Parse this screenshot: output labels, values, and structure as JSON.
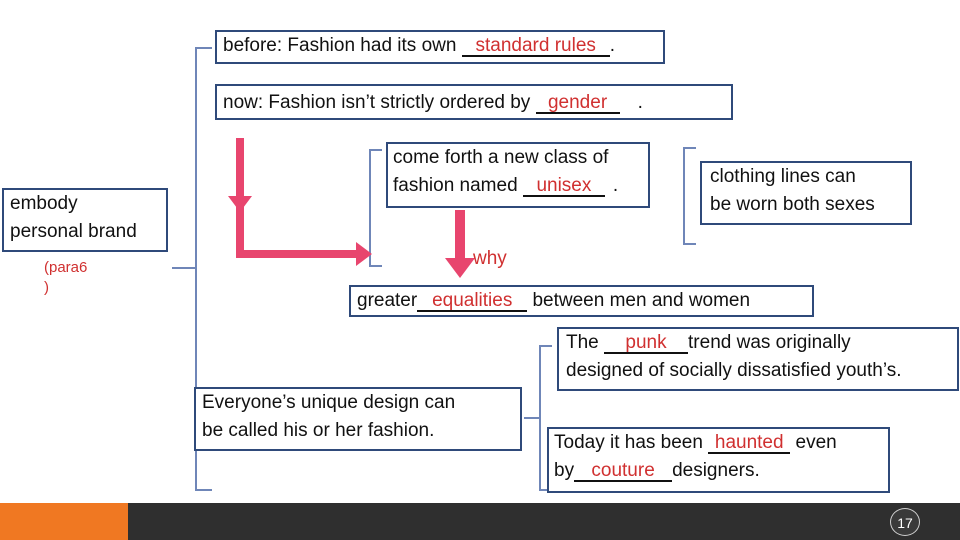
{
  "before": {
    "prefix": "before: Fashion had its own ",
    "answer": "standard rules",
    "suffix": "."
  },
  "now": {
    "prefix": "now: Fashion isn’t strictly ordered by ",
    "answer": "gender",
    "suffix": "."
  },
  "unisex_box": {
    "line1": "come forth a new class of",
    "prefix": "fashion named ",
    "answer": "unisex",
    "suffix": "."
  },
  "clothing_box": {
    "line1": "clothing lines can",
    "line2": "be worn both sexes"
  },
  "embody_box": {
    "line1": "embody",
    "line2": "personal brand"
  },
  "para_note": {
    "line1": "(para6",
    "line2": ")"
  },
  "why_label": "why",
  "equality": {
    "prefix": "greater",
    "answer": "equalities",
    "suffix": " between men and women"
  },
  "punk_box": {
    "prefix": "The ",
    "answer": "punk",
    "suffix": "trend was originally",
    "line2": "designed of socially dissatisfied youth’s."
  },
  "unique_box": {
    "line1": "Everyone’s unique design can",
    "line2": "be called his or her fashion."
  },
  "haunted_box": {
    "prefix": "Today it has been ",
    "answer": "haunted",
    "suffix": " even",
    "line2_prefix": "by",
    "answer2": "couture",
    "line2_suffix": "designers."
  },
  "page_number": "17",
  "colors": {
    "box_border": "#2f4a7a",
    "answer_red": "#d03030",
    "arrow_pink": "#e8456e",
    "bracket_blue": "#6f86b8",
    "footer_orange": "#f07822",
    "footer_dark": "#2f2f2f"
  }
}
